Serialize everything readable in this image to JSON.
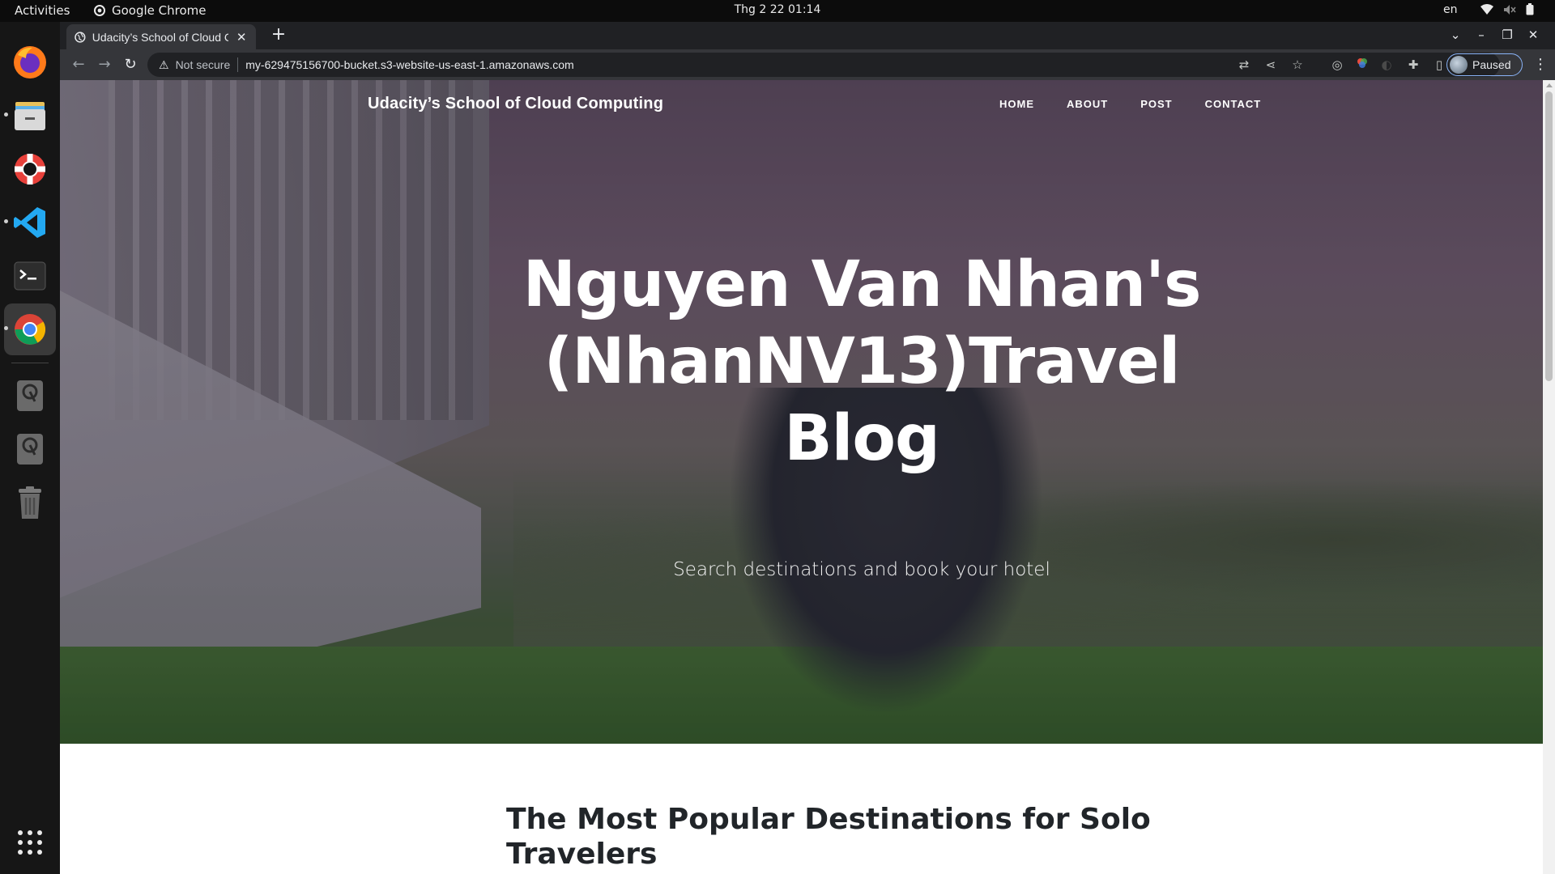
{
  "system": {
    "activities": "Activities",
    "app_name": "Google Chrome",
    "clock": "Thg 2 22  01:14",
    "language": "en"
  },
  "dock": {
    "items": [
      "firefox-icon",
      "files-icon",
      "help-icon",
      "vscode-icon",
      "terminal-icon",
      "chrome-icon",
      "disk-icon",
      "disk-icon",
      "trash-icon",
      "app-grid-icon"
    ]
  },
  "browser": {
    "tab_title": "Udacity’s School of Cloud Computing",
    "tab_close": "✕",
    "new_tab": "+",
    "not_secure": "Not secure",
    "url": "my-629475156700-bucket.s3-website-us-east-1.amazonaws.com",
    "profile_status": "Paused"
  },
  "site": {
    "brand": "Udacity’s School of Cloud Computing",
    "nav": [
      "HOME",
      "ABOUT",
      "POST",
      "CONTACT"
    ],
    "hero_title": "Nguyen Van Nhan's (NhanNV13)Travel Blog",
    "hero_subtitle": "Search destinations and book your hotel",
    "section_title": "The Most Popular Destinations for Solo Travelers"
  }
}
